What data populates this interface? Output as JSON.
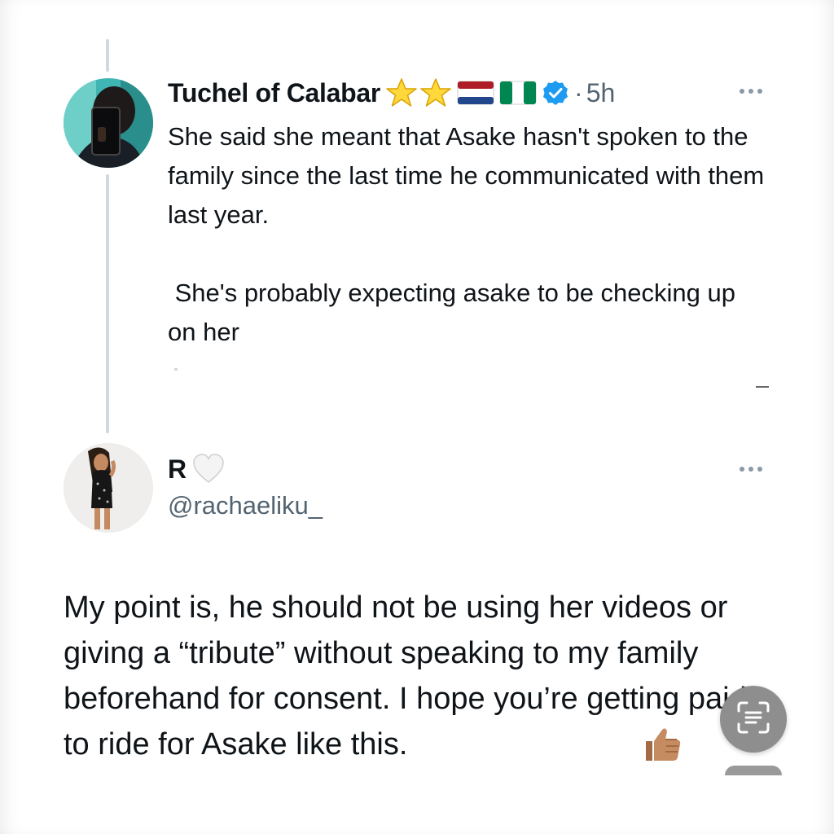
{
  "thread": {
    "parent": {
      "display_name": "Tuchel of Calabar",
      "badges": [
        "star-emoji",
        "star-emoji",
        "netherlands-flag-emoji",
        "nigeria-flag-emoji",
        "verified-badge-icon"
      ],
      "separator": "·",
      "time": "5h",
      "text": "She said she meant that Asake hasn't spoken to the family since the last time he communicated with them last year.\n\n She's probably expecting asake to be checking up on her"
    },
    "reply": {
      "display_name": "R",
      "name_emoji": "white-heart-emoji",
      "handle": "@rachaeliku_",
      "text": "My point is, he should not be using her videos or giving a “tribute” without speaking to my family beforehand for consent. I hope you’re getting paid to ride for Asake like this. ",
      "trailing_emoji": "thumbs-up-emoji"
    }
  },
  "icons": {
    "more": "more-horizontal-icon",
    "scan": "text-scan-icon"
  },
  "colors": {
    "verified": "#1d9bf0",
    "secondary_text": "#536471",
    "thread_line": "#cfd9de"
  }
}
